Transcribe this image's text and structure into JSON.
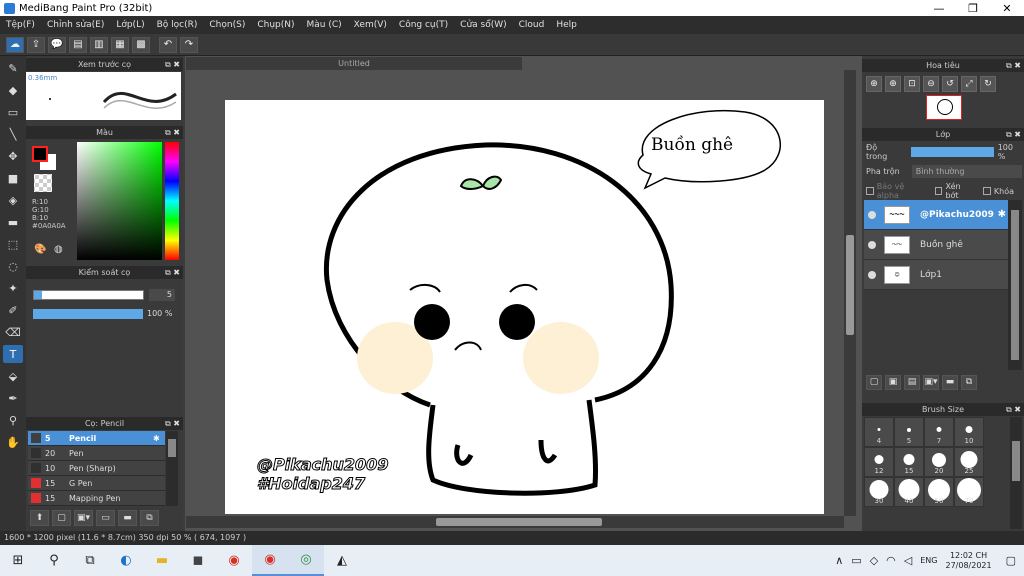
{
  "window": {
    "title": "MediBang Paint Pro (32bit)",
    "minimize": "—",
    "maximize": "❐",
    "close": "✕"
  },
  "menu": [
    "Tệp(F)",
    "Chỉnh sửa(E)",
    "Lớp(L)",
    "Bộ lọc(R)",
    "Chọn(S)",
    "Chụp(N)",
    "Màu (C)",
    "Xem(V)",
    "Công cụ(T)",
    "Cửa sổ(W)",
    "Cloud",
    "Help"
  ],
  "toolbar_icons": {
    "cloud": "☁",
    "share": "⇪",
    "chat": "💬",
    "note": "▤",
    "page": "▥",
    "pages": "▦",
    "grid": "▩",
    "undo": "↶",
    "redo": "↷"
  },
  "tools": {
    "brush": "✎",
    "eraser": "◆",
    "rect": "▭",
    "line": "╲",
    "move": "✥",
    "fill_rect": "■",
    "bucket": "◈",
    "gradient": "▬",
    "select_rect": "⬚",
    "lasso": "◌",
    "wand": "✦",
    "select_pen": "✐",
    "select_erase": "⌫",
    "text": "T",
    "hand_fill": "⬙",
    "dropper": "✒",
    "pipette": "⚲",
    "hand": "✋"
  },
  "panels": {
    "brush_preview": {
      "title": "Xem trước cọ",
      "size": "0.36mm",
      "ctl": "⧉ ✖"
    },
    "color": {
      "title": "Màu",
      "ctl": "⧉ ✖",
      "r": "R:10",
      "g": "G:10",
      "b": "B:10",
      "hex": "#0A0A0A",
      "icon_palette": "🎨",
      "icon_swatch": "◍"
    },
    "control": {
      "title": "Kiểm soát cọ",
      "ctl": "⧉ ✖",
      "size_value": "5",
      "opacity_value": "100 %"
    },
    "brush": {
      "title": "Cọ: Pencil",
      "ctl": "⧉ ✖",
      "items": [
        {
          "num": "5",
          "name": "Pencil",
          "active": true,
          "chip": "#404040"
        },
        {
          "num": "20",
          "name": "Pen",
          "active": false,
          "chip": "#303030"
        },
        {
          "num": "10",
          "name": "Pen (Sharp)",
          "active": false,
          "chip": "#303030"
        },
        {
          "num": "15",
          "name": "G Pen",
          "active": false,
          "chip": "#e03030"
        },
        {
          "num": "15",
          "name": "Mapping Pen",
          "active": false,
          "chip": "#e03030"
        }
      ],
      "gear": "✱",
      "tools": [
        "⬆",
        "▢",
        "▣▾",
        "▭",
        "▬",
        "⧉"
      ]
    },
    "navigator": {
      "title": "Hoa tiêu",
      "ctl": "⧉ ✖",
      "tools": [
        "⊕",
        "⊕",
        "⊡",
        "⊖",
        "↺",
        "⤢",
        "↻"
      ]
    },
    "layer": {
      "title": "Lớp",
      "ctl": "⧉ ✖",
      "opacity_label": "Độ trong",
      "opacity_value": "100 %",
      "blend_label": "Pha trộn",
      "blend_value": "Bình thường",
      "checks": [
        "Bảo vệ alpha",
        "Xén bớt",
        "Khóa"
      ],
      "items": [
        {
          "name": "@Pikachu2009",
          "active": true,
          "thumb": "～～～"
        },
        {
          "name": "Buồn ghê",
          "active": false,
          "thumb": "～～"
        },
        {
          "name": "Lớp1",
          "active": false,
          "thumb": "☺"
        }
      ],
      "gear": "✱",
      "tools": [
        "▢",
        "▣",
        "▤",
        "▣▾",
        "▬",
        "⧉"
      ]
    },
    "brush_size": {
      "title": "Brush Size",
      "ctl": "⧉ ✖",
      "sizes": [
        "4",
        "5",
        "7",
        "10",
        "12",
        "15",
        "20",
        "25",
        "30",
        "40",
        "50",
        "70"
      ]
    }
  },
  "canvas": {
    "tab": "Untitled",
    "bubble_text": "Buồn ghê",
    "watermark1": "@Pikachu2009",
    "watermark2": "#Hoidap247"
  },
  "status": "1600 * 1200 pixel   (11.6 * 8.7cm)   350 dpi   50 %   ( 674, 1097 )",
  "taskbar": {
    "icons": {
      "start": "⊞",
      "search": "⚲",
      "taskview": "⧉",
      "edge": "◐",
      "explorer": "▬",
      "store": "◼",
      "chrome": "◉",
      "chrome2": "◉",
      "medibang": "◎",
      "app": "◭"
    },
    "tray": {
      "chevron": "∧",
      "battery": "▭",
      "network": "◇",
      "wifi": "◠",
      "volume": "◁",
      "lang": "ENG"
    },
    "time": "12:02 CH",
    "date": "27/08/2021",
    "notify": "▢"
  }
}
